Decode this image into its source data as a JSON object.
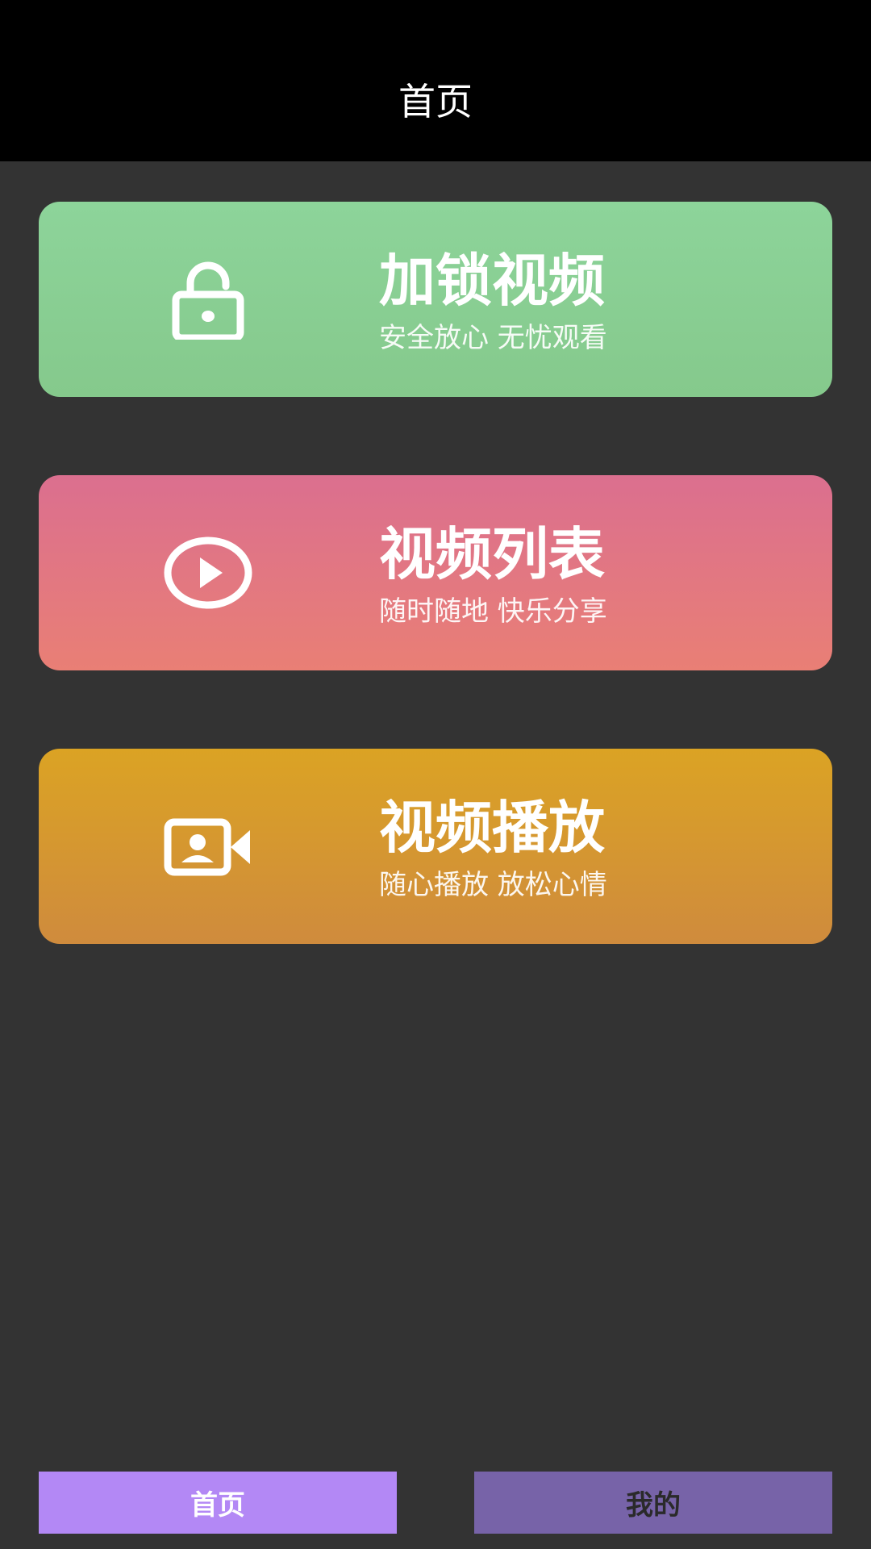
{
  "header": {
    "title": "首页"
  },
  "cards": [
    {
      "title": "加锁视频",
      "subtitle": "安全放心 无忧观看",
      "icon": "unlocked-padlock-icon",
      "color_top": "#8dd49a",
      "color_bottom": "#85c98c"
    },
    {
      "title": "视频列表",
      "subtitle": "随时随地 快乐分享",
      "icon": "play-circle-icon",
      "color_top": "#db6f8f",
      "color_bottom": "#e97f75"
    },
    {
      "title": "视频播放",
      "subtitle": "随心播放 放松心情",
      "icon": "video-camera-person-icon",
      "color_top": "#dba324",
      "color_bottom": "#cf8b3d"
    }
  ],
  "bottom_nav": {
    "home_label": "首页",
    "mine_label": "我的",
    "active_tab": "首页",
    "active_color": "#b388f5",
    "inactive_color": "#7763a8"
  },
  "colors": {
    "background": "#333333",
    "header_background": "#000000"
  }
}
